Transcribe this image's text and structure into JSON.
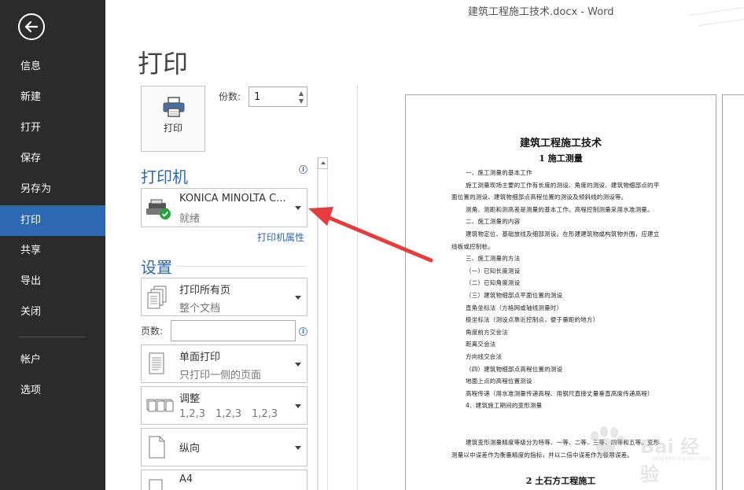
{
  "window": {
    "title": "建筑工程施工技术.docx - Word"
  },
  "sidebar": {
    "back_icon": "back-arrow-icon",
    "items": [
      {
        "label": "信息",
        "active": false
      },
      {
        "label": "新建",
        "active": false
      },
      {
        "label": "打开",
        "active": false
      },
      {
        "label": "保存",
        "active": false
      },
      {
        "label": "另存为",
        "active": false
      },
      {
        "label": "打印",
        "active": true
      },
      {
        "label": "共享",
        "active": false
      },
      {
        "label": "导出",
        "active": false
      },
      {
        "label": "关闭",
        "active": false
      }
    ],
    "bottom_items": [
      {
        "label": "帐户"
      },
      {
        "label": "选项"
      }
    ],
    "colors": {
      "background": "#2b2b2b",
      "active": "#2e68b2"
    }
  },
  "print": {
    "heading": "打印",
    "button_label": "打印",
    "copies_label": "份数:",
    "copies_value": "1"
  },
  "printer": {
    "heading": "打印机",
    "name": "KONICA MINOLTA C...",
    "status": "就绪",
    "properties_link": "打印机属性"
  },
  "settings": {
    "heading": "设置",
    "print_range": {
      "main": "打印所有页",
      "sub": "整个文档"
    },
    "pages_label": "页数:",
    "pages_value": "",
    "sides": {
      "main": "单面打印",
      "sub": "只打印一侧的页面"
    },
    "collate": {
      "main": "调整",
      "sub1": "1,2,3",
      "sub2": "1,2,3",
      "sub3": "1,2,3"
    },
    "orientation": {
      "main": "纵向"
    },
    "paper": {
      "main": "A4"
    }
  },
  "preview": {
    "doc_title": "建筑工程施工技术",
    "section1": "1 施工测量",
    "lines": [
      "一、施工测量的基本工作",
      "施工测量现场主要的工作有长度的测设、角度的测设、建筑物细部点的平",
      "面位置的测设、建筑物细部点高程位置的测设及倾斜线的测设等。",
      "测角、测距和测高差是测量的基本工作。高程控制测量采用水准测量。",
      "二、施工测量的内容",
      "建筑物定位、基础放线及细部测设。在形建建筑物或构筑物外围，应建立",
      "线板或控制桩。",
      "三、施工测量的方法",
      "（一）已知长度测设",
      "（二）已知角度测设",
      "（三）建筑物细部点平面位置的测设",
      "直角坐标法（方格网或轴线测量时）",
      "极坐标法（测设点靠近控制点，便于量距的地方）",
      "角度前方交会法",
      "距离交会法",
      "方向线交会法",
      "（四）建筑物细部点高程位置的测设",
      "地面上点的高程位置测设",
      "高程传递（用水准测量传递高程、用钢尺直接丈量垂直高度传递高程）",
      "4、建筑施工期间的变形测量",
      "",
      "",
      "建筑变形测量精度等级分为特等、一等、二等、三等、四等和五等。变形",
      "测量以中误差作为衡量精度的指标，并以二倍中误差作为极限误差。"
    ],
    "section2": "2 土石方工程施工"
  },
  "watermark": {
    "text": "Bai 经验",
    "url": "jingyan.baidu.com"
  },
  "annotation": {
    "arrow_color": "#e53d3d"
  }
}
